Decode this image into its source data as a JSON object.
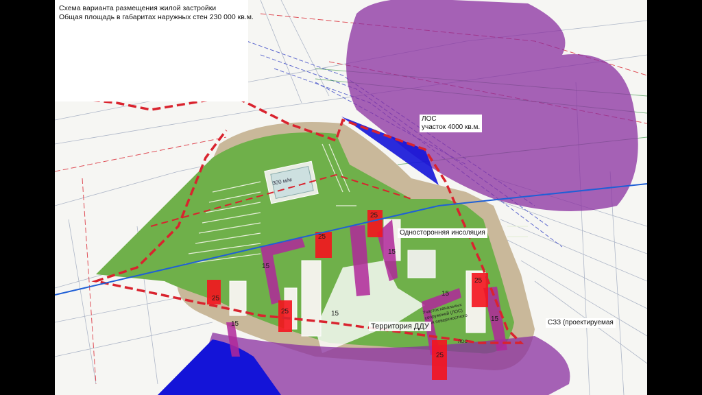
{
  "title": {
    "line1": "Схема варианта размещения жилой застройки",
    "line2": "Общая площадь в габаритах наружных стен 230 000 кв.м."
  },
  "labels": {
    "los": "ЛОС",
    "los_area": "участок 4000 кв.м.",
    "one_sided_insolation": "Односторонняя инсоляция",
    "szz": "СЗЗ (проектируемая",
    "ddu": "Территория ДДУ",
    "parking_area": "300 м/м",
    "treatment_facility_line1": "Участок канальных",
    "treatment_facility_line2": "сооружений (ЛОС)",
    "treatment_facility_line3": "для поверхностного",
    "los_small": "ЛОС"
  },
  "floors": {
    "b25a": "25",
    "b15a": "15",
    "b25b": "25",
    "b15b": "15",
    "b25c": "25",
    "b15c": "15",
    "b25d": "25",
    "b15d": "15",
    "b25e": "25",
    "b15e": "15",
    "b25f": "25",
    "b15f": "15"
  },
  "colors": {
    "boundary_red": "#d9232e",
    "zone_purple": "#8a2fa0",
    "zone_blue": "#1414d8",
    "green_site": "#6fb04a",
    "road_tan": "#c9b89a",
    "building_red": "#f4141e",
    "building_magenta": "#b0289a"
  }
}
